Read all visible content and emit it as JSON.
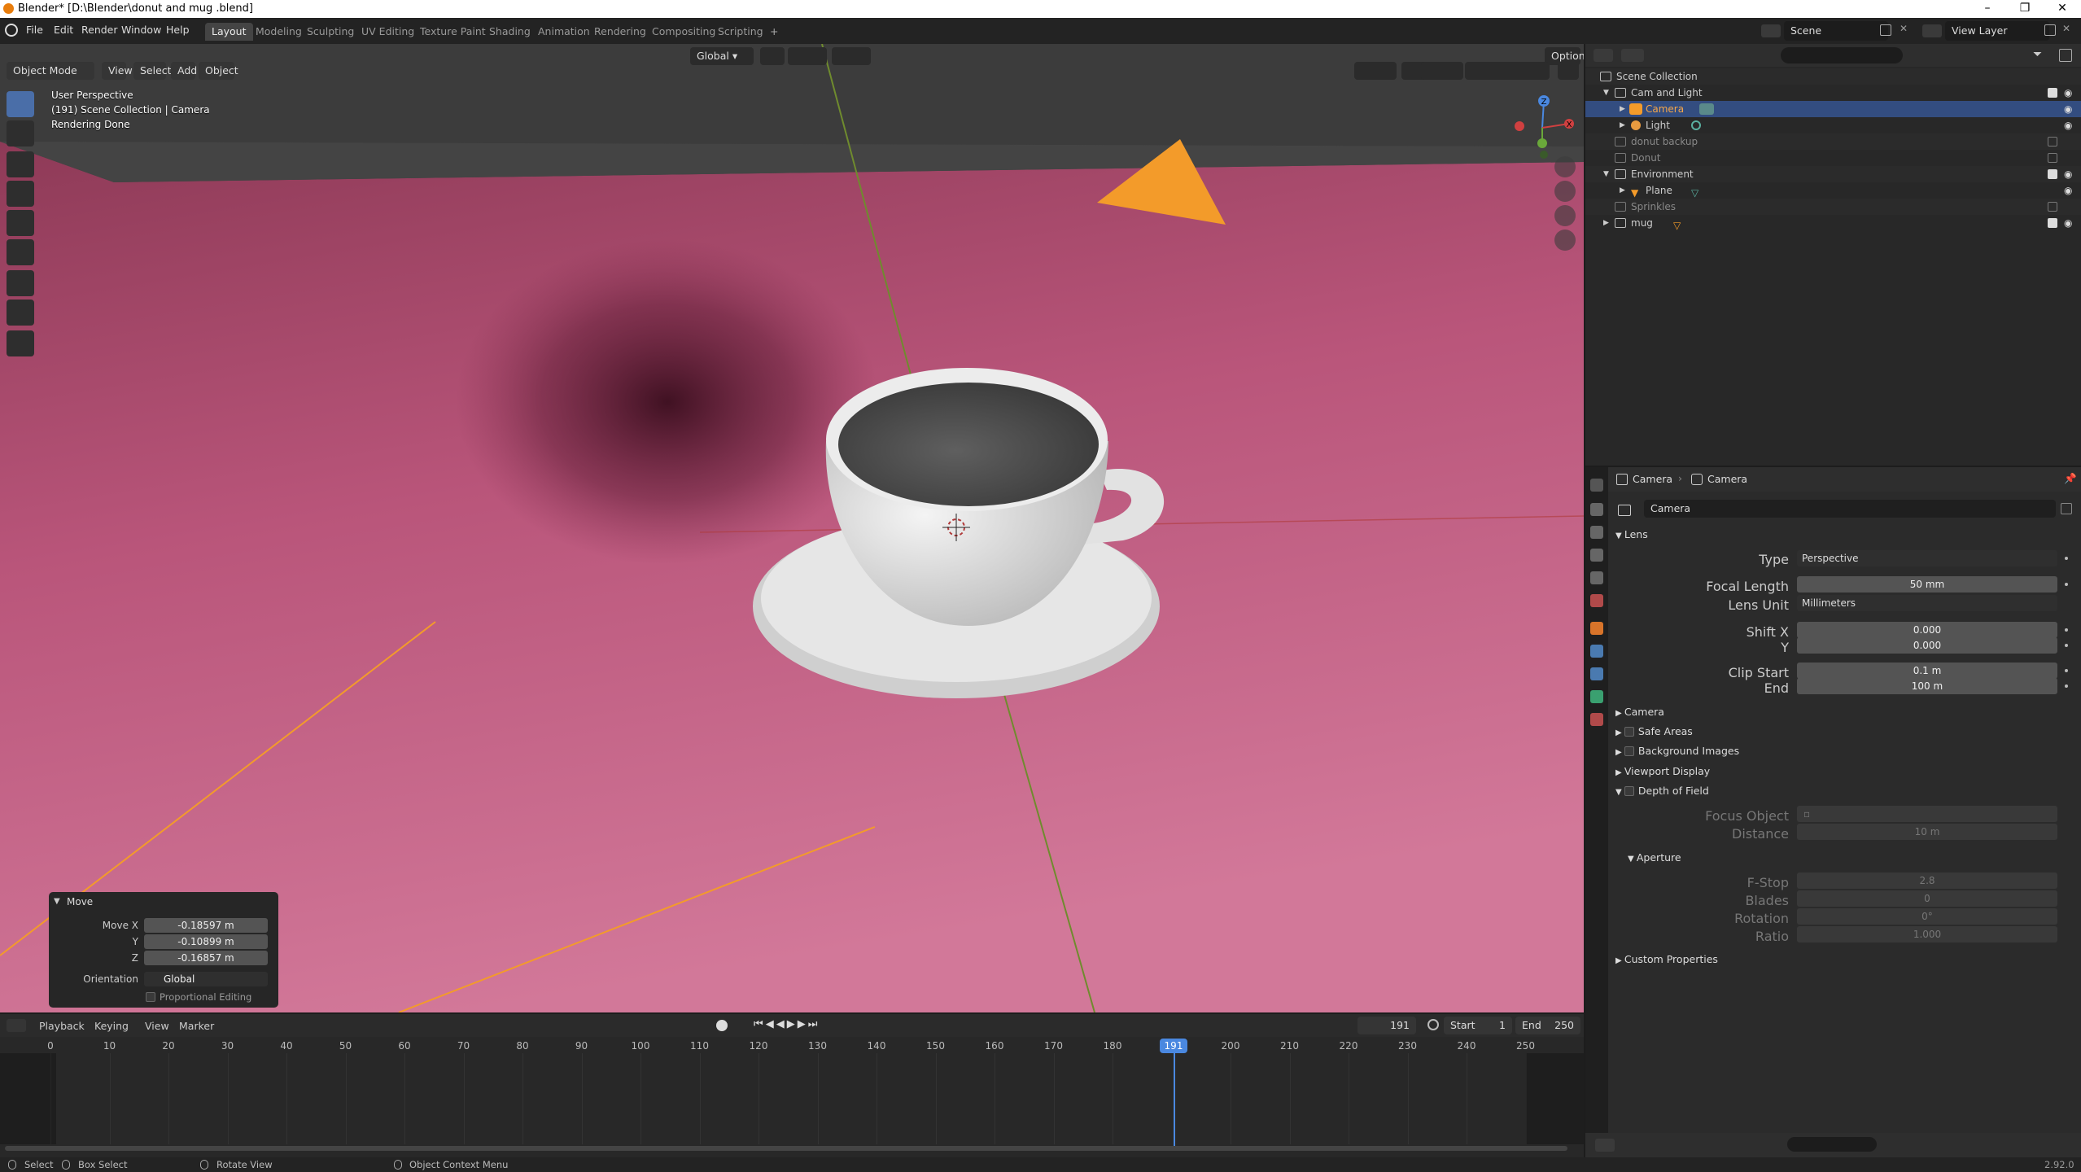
{
  "window": {
    "title": "Blender* [D:\\Blender\\donut and mug .blend]"
  },
  "topbar": {
    "menus": [
      "File",
      "Edit",
      "Render",
      "Window",
      "Help"
    ],
    "workspaces": [
      "Layout",
      "Modeling",
      "Sculpting",
      "UV Editing",
      "Texture Paint",
      "Shading",
      "Animation",
      "Rendering",
      "Compositing",
      "Scripting"
    ],
    "active_workspace": "Layout",
    "add_tab": "+",
    "scene": "Scene",
    "view_layer": "View Layer"
  },
  "viewport": {
    "mode": "Object Mode",
    "menus": [
      "View",
      "Select",
      "Add",
      "Object"
    ],
    "orientation": "Global",
    "options": "Options",
    "info_line1": "User Perspective",
    "info_line2": "(191) Scene Collection | Camera",
    "info_line3": "Rendering Done",
    "gizmo": {
      "z": "Z",
      "x": "X"
    }
  },
  "operator_panel": {
    "title": "Move",
    "move_x_label": "Move X",
    "move_x": "-0.18597 m",
    "y_label": "Y",
    "y": "-0.10899 m",
    "z_label": "Z",
    "z": "-0.16857 m",
    "orientation_label": "Orientation",
    "orientation": "Global",
    "proportional": "Proportional Editing"
  },
  "timeline": {
    "menus": [
      "Playback",
      "Keying",
      "View",
      "Marker"
    ],
    "current_frame": "191",
    "start_label": "Start",
    "start": "1",
    "end_label": "End",
    "end": "250",
    "ticks": [
      "0",
      "10",
      "20",
      "30",
      "40",
      "50",
      "60",
      "70",
      "80",
      "90",
      "100",
      "110",
      "120",
      "130",
      "140",
      "150",
      "160",
      "170",
      "180",
      "191",
      "200",
      "210",
      "220",
      "230",
      "240",
      "250"
    ]
  },
  "outliner": {
    "root": "Scene Collection",
    "rows": [
      {
        "label": "Cam and Light"
      },
      {
        "label": "Camera"
      },
      {
        "label": "Light"
      },
      {
        "label": "donut backup"
      },
      {
        "label": "Donut"
      },
      {
        "label": "Environment"
      },
      {
        "label": "Plane"
      },
      {
        "label": "Sprinkles"
      },
      {
        "label": "mug"
      }
    ]
  },
  "properties": {
    "breadcrumb1": "Camera",
    "breadcrumb2": "Camera",
    "datablock": "Camera",
    "lens_section": "Lens",
    "type_label": "Type",
    "type": "Perspective",
    "focal_label": "Focal Length",
    "focal": "50 mm",
    "unit_label": "Lens Unit",
    "unit": "Millimeters",
    "shiftx_label": "Shift X",
    "shiftx": "0.000",
    "shifty_label": "Y",
    "shifty": "0.000",
    "clipstart_label": "Clip Start",
    "clipstart": "0.1 m",
    "clipend_label": "End",
    "clipend": "100 m",
    "sections": [
      "Camera",
      "Safe Areas",
      "Background Images",
      "Viewport Display",
      "Depth of Field"
    ],
    "focus_label": "Focus Object",
    "distance_label": "Distance",
    "distance": "10 m",
    "aperture": "Aperture",
    "fstop_label": "F-Stop",
    "fstop": "2.8",
    "blades_label": "Blades",
    "blades": "0",
    "rotation_label": "Rotation",
    "rotation": "0°",
    "ratio_label": "Ratio",
    "ratio": "1.000",
    "custom": "Custom Properties"
  },
  "statusbar": {
    "select": "Select",
    "box_select": "Box Select",
    "rotate": "Rotate View",
    "context": "Object Context Menu",
    "version": "2.92.0"
  },
  "colors": {
    "accent": "#4a6ea8",
    "frame_marker": "#4a88e0",
    "plane": "#c0607f",
    "camera_gizmo": "#f39b2a"
  }
}
